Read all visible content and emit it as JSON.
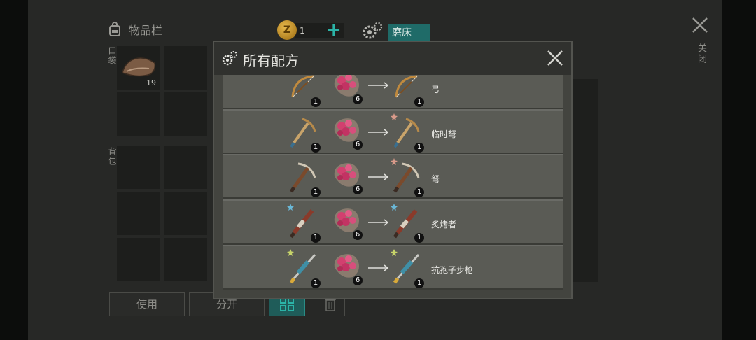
{
  "inventory": {
    "title": "物品栏",
    "pocket_label": "口袋",
    "backpack_label": "背包",
    "first_slot_count": "19",
    "coins": "1",
    "workbench_tab": "磨床",
    "use_label": "使用",
    "split_label": "分开",
    "close_label": "关闭"
  },
  "modal": {
    "title": "所有配方",
    "recipes": [
      {
        "result": "弓",
        "input_qty": "1",
        "material_qty": "6",
        "output_qty": "1"
      },
      {
        "result": "临时弩",
        "input_qty": "1",
        "material_qty": "6",
        "output_qty": "1"
      },
      {
        "result": "弩",
        "input_qty": "1",
        "material_qty": "6",
        "output_qty": "1"
      },
      {
        "result": "炙烤者",
        "input_qty": "1",
        "material_qty": "6",
        "output_qty": "1"
      },
      {
        "result": "抗孢子步枪",
        "input_qty": "1",
        "material_qty": "6",
        "output_qty": "1"
      }
    ]
  },
  "colors": {
    "accent_teal": "#2bb3a7",
    "modal_bg": "#43443f",
    "row_bg": "#5a5b55"
  }
}
